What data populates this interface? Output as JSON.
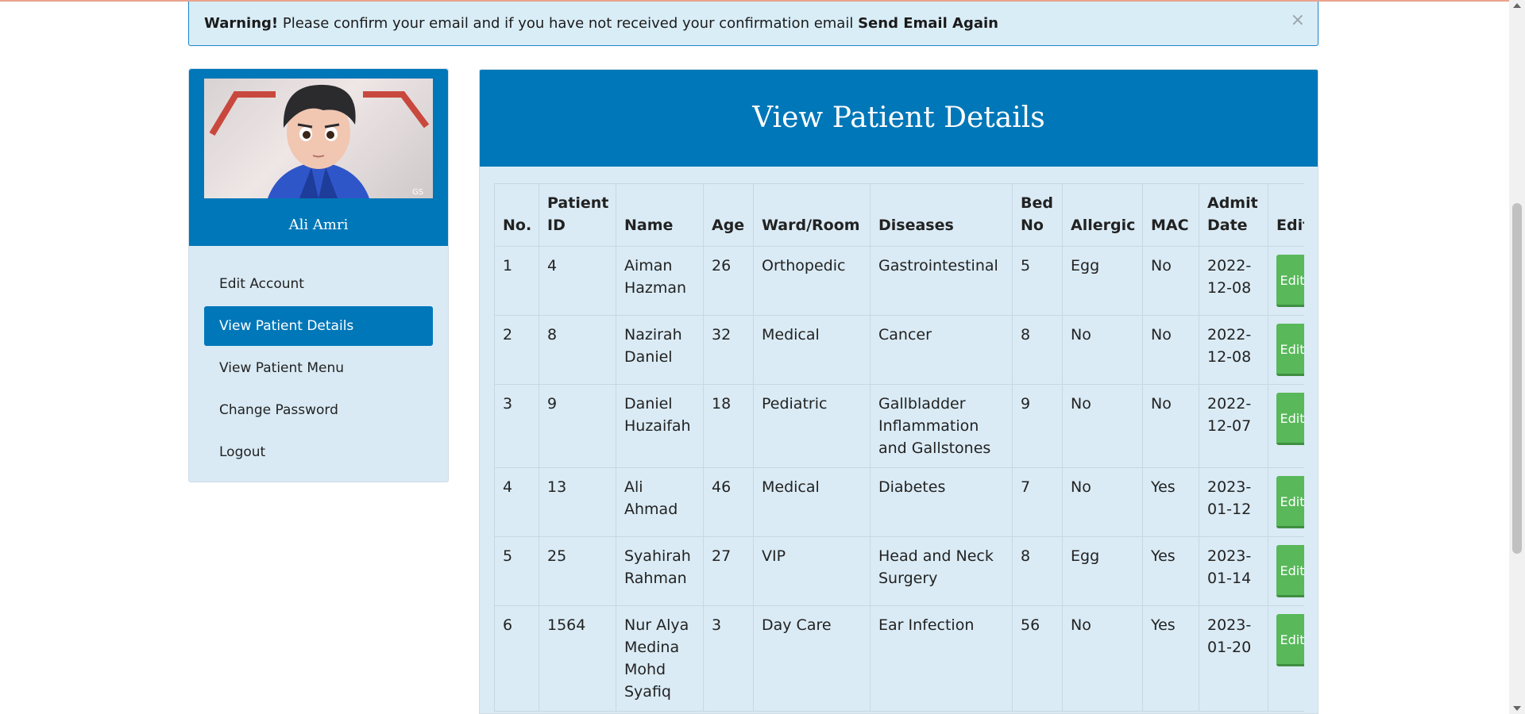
{
  "alert": {
    "strong": "Warning!",
    "message": " Please confirm your email and if you have not received your confirmation email ",
    "link": "Send Email Again",
    "close": "×"
  },
  "sidebar": {
    "user_name": "Ali Amri",
    "items": [
      {
        "label": "Edit Account",
        "active": false
      },
      {
        "label": "View Patient Details",
        "active": true
      },
      {
        "label": "View Patient Menu",
        "active": false
      },
      {
        "label": "Change Password",
        "active": false
      },
      {
        "label": "Logout",
        "active": false
      }
    ]
  },
  "panel": {
    "title": "View Patient Details"
  },
  "table": {
    "headers": [
      "No.",
      "Patient ID",
      "Name",
      "Age",
      "Ward/Room",
      "Diseases",
      "Bed No",
      "Allergic",
      "MAC",
      "Admit Date",
      "Edit"
    ],
    "rows": [
      [
        "1",
        "4",
        "Aiman Hazman",
        "26",
        "Orthopedic",
        "Gastrointestinal",
        "5",
        "Egg",
        "No",
        "2022-12-08"
      ],
      [
        "2",
        "8",
        "Nazirah Daniel",
        "32",
        "Medical",
        "Cancer",
        "8",
        "No",
        "No",
        "2022-12-08"
      ],
      [
        "3",
        "9",
        "Daniel Huzaifah",
        "18",
        "Pediatric",
        "Gallbladder Inflammation and Gallstones",
        "9",
        "No",
        "No",
        "2022-12-07"
      ],
      [
        "4",
        "13",
        "Ali Ahmad",
        "46",
        "Medical",
        "Diabetes",
        "7",
        "No",
        "Yes",
        "2023-01-12"
      ],
      [
        "5",
        "25",
        "Syahirah Rahman",
        "27",
        "VIP",
        "Head and Neck Surgery",
        "8",
        "Egg",
        "Yes",
        "2023-01-14"
      ],
      [
        "6",
        "1564",
        "Nur Alya Medina Mohd Syafiq",
        "3",
        "Day Care",
        "Ear Infection",
        "56",
        "No",
        "Yes",
        "2023-01-20"
      ]
    ],
    "edit_label": "Edit"
  },
  "colors": {
    "primary": "#0077b8",
    "alert_bg": "#d9edf7",
    "panel_bg": "#daebf5",
    "edit_button": "#58b85a"
  }
}
